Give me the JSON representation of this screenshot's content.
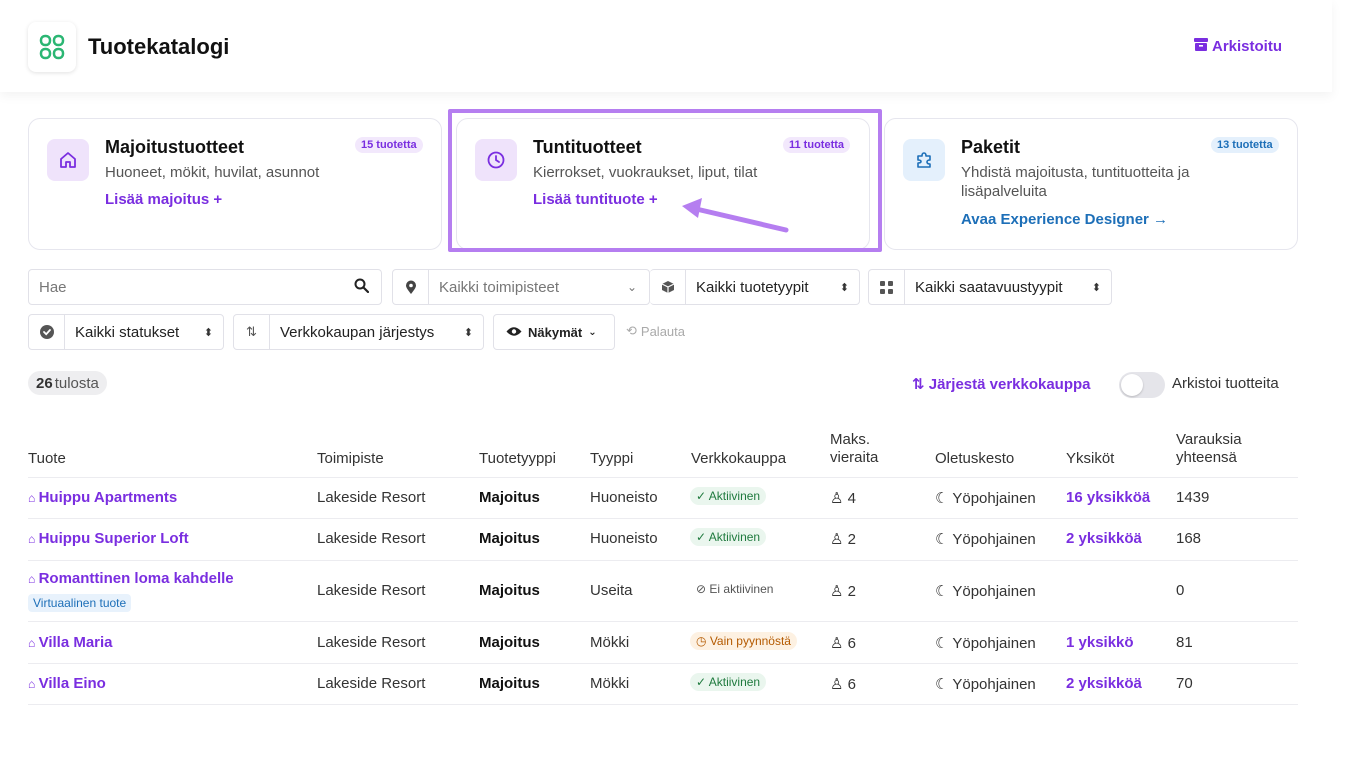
{
  "header": {
    "title": "Tuotekatalogi",
    "archived_link": "Arkistoitu"
  },
  "cards": [
    {
      "title": "Majoitustuotteet",
      "badge": "15 tuotetta",
      "desc": "Huoneet, mökit, huvilat, asunnot",
      "link": "Lisää majoitus +",
      "icon": "home-icon"
    },
    {
      "title": "Tuntituotteet",
      "badge": "11 tuotetta",
      "desc": "Kierrokset, vuokraukset, liput, tilat",
      "link": "Lisää tuntituote +",
      "icon": "clock-icon"
    },
    {
      "title": "Paketit",
      "badge": "13 tuotetta",
      "desc1": "Yhdistä majoitusta, tuntituotteita ja",
      "desc2": "lisäpalveluita",
      "link": "Avaa Experience Designer →",
      "icon": "puzzle-icon"
    }
  ],
  "filters": {
    "search_placeholder": "Hae",
    "location": "Kaikki toimipisteet",
    "product_types": "Kaikki tuotetyypit",
    "availability_types": "Kaikki saatavuustyypit",
    "statuses": "Kaikki statukset",
    "shop_order": "Verkkokaupan järjestys",
    "views": "Näkymät",
    "reset": "Palauta"
  },
  "results": {
    "count": "26",
    "label": "tulosta"
  },
  "actions": {
    "sort_shop": "Järjestä verkkokauppa",
    "archive_toggle_label": "Arkistoi tuotteita"
  },
  "table": {
    "headers": {
      "product": "Tuote",
      "location": "Toimipiste",
      "product_type": "Tuotetyyppi",
      "type": "Tyyppi",
      "shop": "Verkkokauppa",
      "max_guests_1": "Maks.",
      "max_guests_2": "vieraita",
      "default_duration": "Oletuskesto",
      "units": "Yksiköt",
      "bookings_1": "Varauksia",
      "bookings_2": "yhteensä"
    },
    "rows": [
      {
        "name": "Huippu Apartments",
        "location": "Lakeside Resort",
        "product_type": "Majoitus",
        "type": "Huoneisto",
        "status": "Aktiivinen",
        "guests": "4",
        "duration": "Yöpohjainen",
        "units": "16 yksikköä",
        "bookings": "1439"
      },
      {
        "name": "Huippu Superior Loft",
        "location": "Lakeside Resort",
        "product_type": "Majoitus",
        "type": "Huoneisto",
        "status": "Aktiivinen",
        "guests": "2",
        "duration": "Yöpohjainen",
        "units": "2 yksikköä",
        "bookings": "168"
      },
      {
        "name": "Romanttinen loma kahdelle",
        "badge": "Virtuaalinen tuote",
        "location": "Lakeside Resort",
        "product_type": "Majoitus",
        "type": "Useita",
        "status": "Ei aktiivinen",
        "guests": "2",
        "duration": "Yöpohjainen",
        "units": "",
        "bookings": "0"
      },
      {
        "name": "Villa Maria",
        "location": "Lakeside Resort",
        "product_type": "Majoitus",
        "type": "Mökki",
        "status": "Vain pyynnöstä",
        "guests": "6",
        "duration": "Yöpohjainen",
        "units": "1 yksikkö",
        "bookings": "81"
      },
      {
        "name": "Villa Eino",
        "location": "Lakeside Resort",
        "product_type": "Majoitus",
        "type": "Mökki",
        "status": "Aktiivinen",
        "guests": "6",
        "duration": "Yöpohjainen",
        "units": "2 yksikköä",
        "bookings": "70"
      }
    ]
  },
  "colors": {
    "accent": "#7a2ee0",
    "highlight": "#b57ef0",
    "link_blue": "#1d6fb8"
  }
}
